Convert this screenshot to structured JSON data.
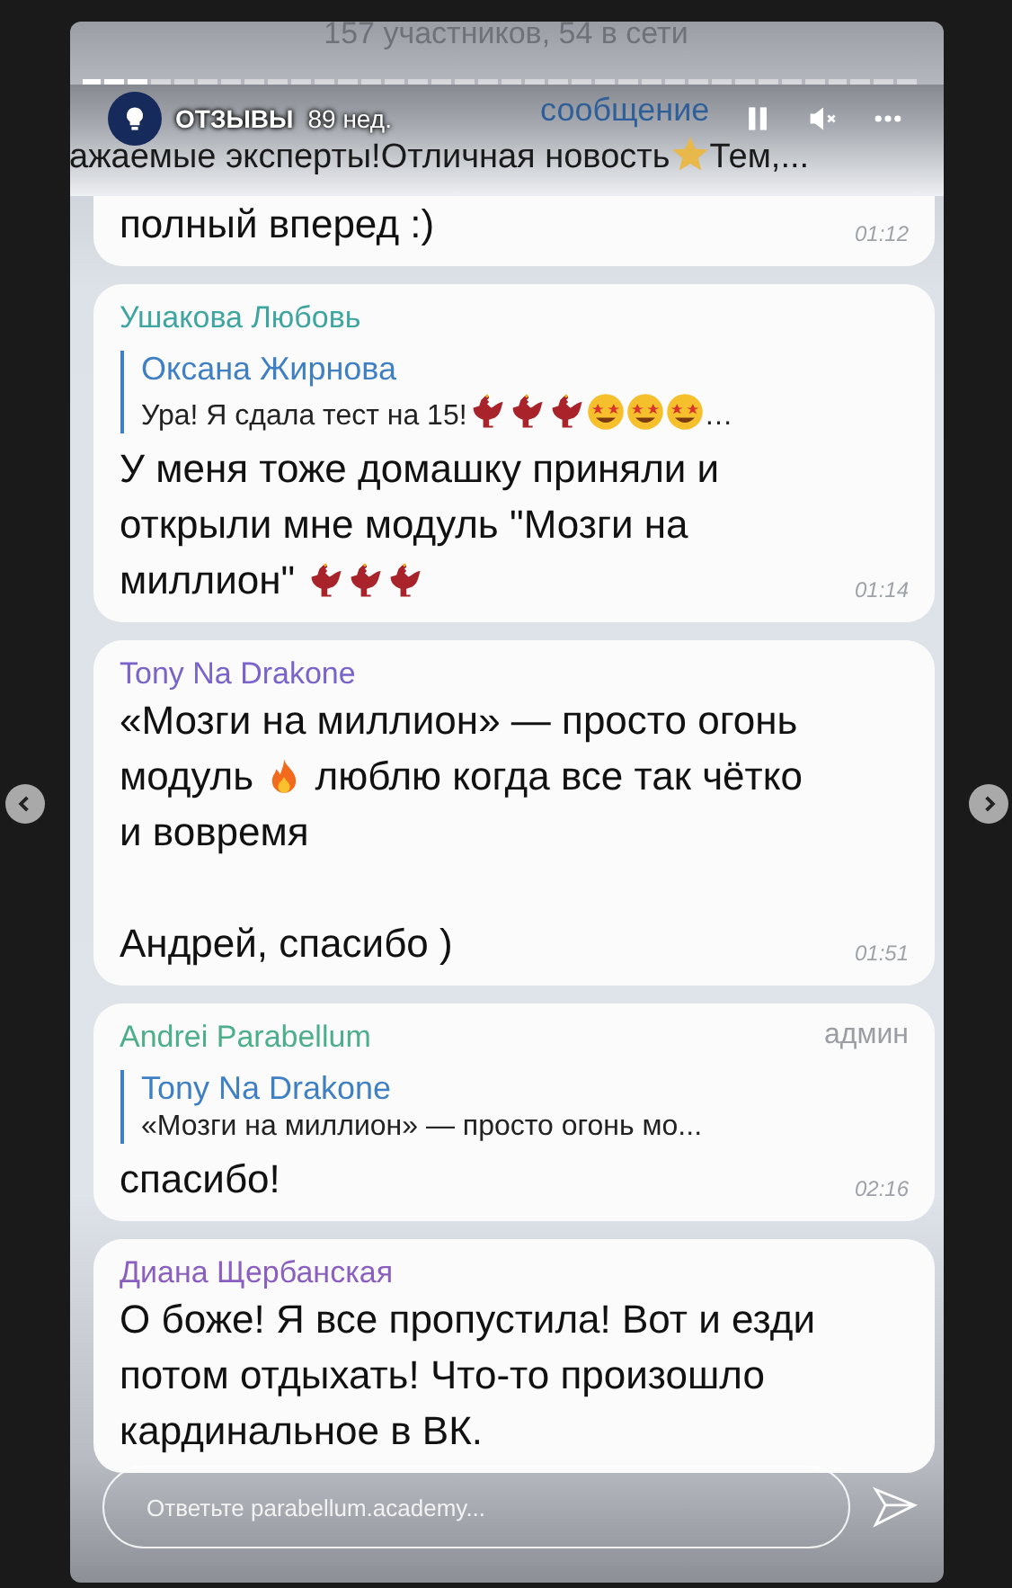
{
  "story": {
    "account": "ОТЗЫВЫ",
    "age": "89 нед.",
    "progress": {
      "segments": [
        {
          "viewed": true
        },
        {
          "viewed": true
        },
        {
          "viewed": true
        },
        {
          "viewed": false
        },
        {
          "viewed": false
        },
        {
          "viewed": false
        },
        {
          "viewed": false
        },
        {
          "viewed": false
        },
        {
          "viewed": false
        },
        {
          "viewed": false
        },
        {
          "viewed": false
        },
        {
          "viewed": false
        },
        {
          "viewed": false
        },
        {
          "viewed": false
        },
        {
          "viewed": false
        },
        {
          "viewed": false
        },
        {
          "viewed": false
        },
        {
          "viewed": false
        },
        {
          "viewed": false
        },
        {
          "viewed": false
        },
        {
          "viewed": false
        },
        {
          "viewed": false
        },
        {
          "viewed": false
        },
        {
          "viewed": false
        },
        {
          "viewed": false
        },
        {
          "viewed": false
        },
        {
          "viewed": false
        },
        {
          "viewed": false
        },
        {
          "viewed": false
        },
        {
          "viewed": false
        },
        {
          "viewed": false
        },
        {
          "viewed": false
        },
        {
          "viewed": false
        },
        {
          "viewed": false
        },
        {
          "viewed": false
        },
        {
          "viewed": false
        }
      ]
    },
    "reply_placeholder": "Ответьте parabellum.academy..."
  },
  "chat": {
    "subtitle": "157 участников, 54 в сети",
    "pinned": {
      "title": "сообщение",
      "parts": [
        {
          "kind": "text",
          "text": "ажаемые эксперты!Отличная новость"
        },
        {
          "kind": "star"
        },
        {
          "kind": "text",
          "text": "Тем,..."
        }
      ]
    },
    "messages": [
      {
        "parts": [
          {
            "kind": "text",
            "text": "полный вперед :)"
          }
        ],
        "time": "01:12"
      },
      {
        "author": "Ушакова Любовь",
        "color": "#3fa5a0",
        "reply": {
          "author": "Оксана Жирнова",
          "parts": [
            {
              "kind": "text",
              "text": "Ура! Я сдала тест на 15!"
            },
            {
              "kind": "rooster"
            },
            {
              "kind": "rooster"
            },
            {
              "kind": "rooster"
            },
            {
              "kind": "starface"
            },
            {
              "kind": "starface"
            },
            {
              "kind": "starface"
            },
            {
              "kind": "text",
              "text": "…"
            }
          ]
        },
        "parts": [
          {
            "kind": "text",
            "text": "У меня тоже домашку приняли и открыли мне модуль \"Мозги на миллион\" "
          },
          {
            "kind": "rooster"
          },
          {
            "kind": "rooster"
          },
          {
            "kind": "rooster"
          }
        ],
        "time": "01:14"
      },
      {
        "author": "Tony Na Drakone",
        "color": "#7a63c9",
        "parts": [
          {
            "kind": "text",
            "text": "«Мозги на миллион» — просто огонь модуль "
          },
          {
            "kind": "fire"
          },
          {
            "kind": "text",
            "text": " люблю когда все так чётко и вовремя"
          },
          {
            "kind": "break"
          },
          {
            "kind": "break"
          },
          {
            "kind": "text",
            "text": "Андрей, спасибо )"
          }
        ],
        "time": "01:51"
      },
      {
        "author": "Andrei Parabellum",
        "color": "#4cae8a",
        "badge": "админ",
        "reply": {
          "author": "Tony Na Drakone",
          "parts": [
            {
              "kind": "text",
              "text": "«Мозги на миллион» — просто огонь мо..."
            }
          ]
        },
        "parts": [
          {
            "kind": "text",
            "text": "спасибо!"
          }
        ],
        "time": "02:16"
      },
      {
        "author": "Диана Щербанская",
        "color": "#8a5fc0",
        "parts": [
          {
            "kind": "text",
            "text": "О боже! Я все пропустила! Вот и езди потом отдыхать! Что-то произошло кардинальное в ВК."
          }
        ]
      }
    ]
  }
}
